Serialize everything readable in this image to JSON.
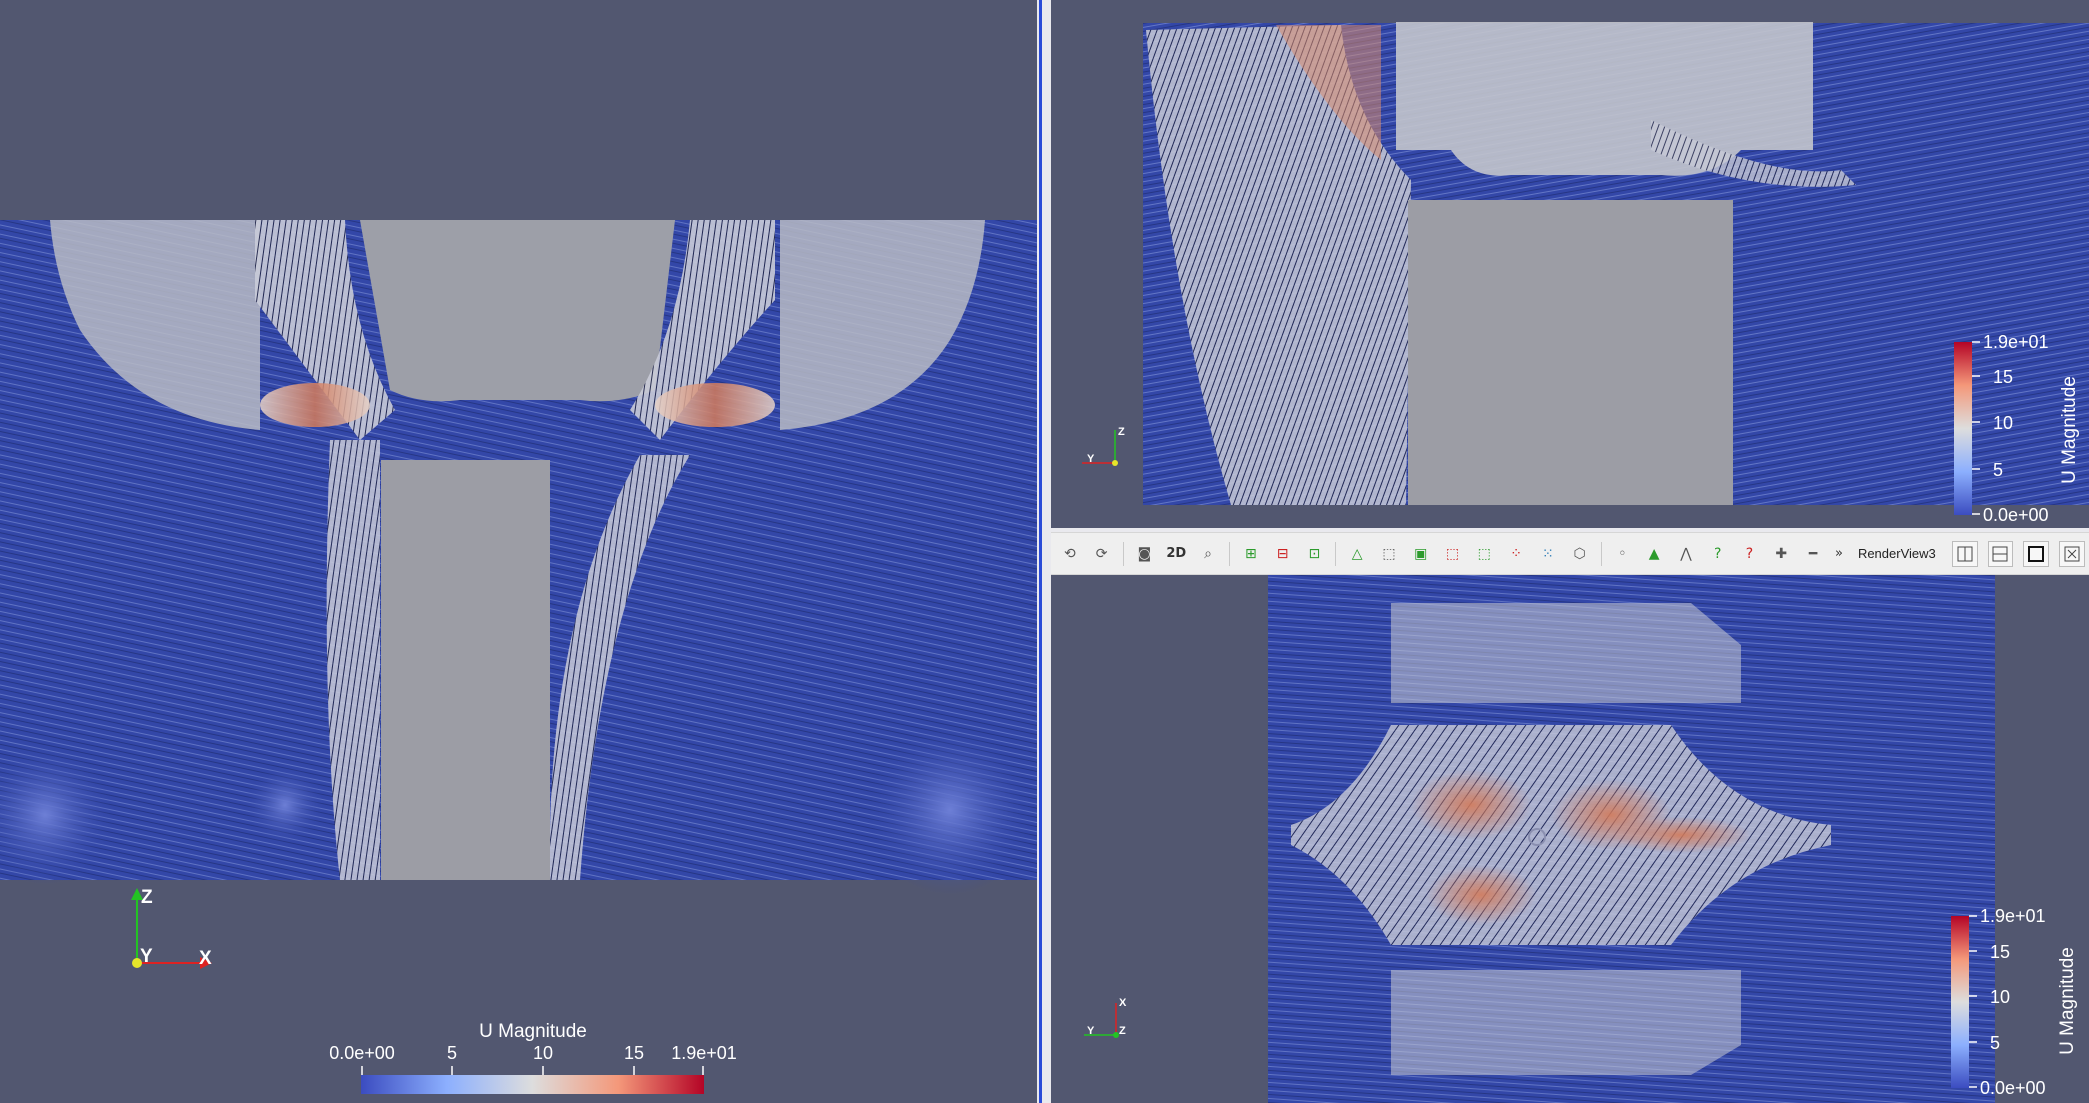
{
  "left_view": {
    "colorbar": {
      "title": "U Magnitude",
      "ticks": [
        "0.0e+00",
        "5",
        "10",
        "15",
        "1.9e+01"
      ]
    },
    "axes": {
      "x": "X",
      "y": "Y",
      "z": "Z"
    }
  },
  "top_right_view": {
    "colorbar": {
      "title": "U Magnitude",
      "ticks": [
        "1.9e+01",
        "15",
        "10",
        "5",
        "0.0e+00"
      ]
    },
    "axes": {
      "y": "Y",
      "z": "Z"
    }
  },
  "bottom_right_view": {
    "toolbar": {
      "view_name": "RenderView3",
      "mode_2d_label": "2D",
      "more_label": "»"
    },
    "colorbar": {
      "title": "U Magnitude",
      "ticks": [
        "1.9e+01",
        "15",
        "10",
        "5",
        "0.0e+00"
      ]
    },
    "axes": {
      "x": "X",
      "y": "Y",
      "z": "Z"
    }
  },
  "colormap": {
    "low": "#3b4cc0",
    "mid": "#dddddd",
    "high": "#b40426"
  },
  "background": "#525770"
}
